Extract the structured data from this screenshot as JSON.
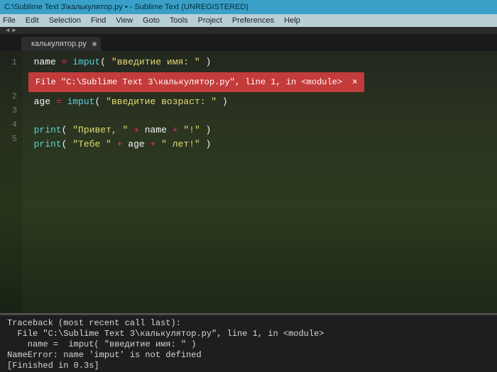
{
  "titleBar": "C:\\Sublime Text 3\\калькулятор.py • - Sublime Text (UNREGISTERED)",
  "menu": [
    "File",
    "Edit",
    "Selection",
    "Find",
    "View",
    "Goto",
    "Tools",
    "Project",
    "Preferences",
    "Help"
  ],
  "tab": {
    "label": "калькулятор.py"
  },
  "gutter": [
    "1",
    "2",
    "3",
    "4",
    "5"
  ],
  "code": {
    "l1": {
      "var": "name",
      "op": "=",
      "fn": "imput",
      "str": "\"введитие имя: \""
    },
    "err": {
      "text": "File \"C:\\Sublime Text 3\\калькулятор.py\", line 1, in <module>",
      "close": "×"
    },
    "l2": {
      "var": "age",
      "op": "=",
      "fn": "imput",
      "str": "\"введитие возраст: \""
    },
    "l4": {
      "fn": "print",
      "s1": "\"Привет, \"",
      "op1": "+",
      "v1": "name",
      "op2": "+",
      "s2": "\"!\""
    },
    "l5": {
      "fn": "print",
      "s1": "\"Тебе \"",
      "op1": "+",
      "v1": "age",
      "op2": "+",
      "s2": "\" лет!\""
    }
  },
  "console": {
    "l1": "Traceback (most recent call last):",
    "l2": "  File \"C:\\Sublime Text 3\\калькулятор.py\", line 1, in <module>",
    "l3": "    name =  imput( \"введитие имя: \" )",
    "l4": "NameError: name 'imput' is not defined",
    "l5": "[Finished in 0.3s]"
  }
}
